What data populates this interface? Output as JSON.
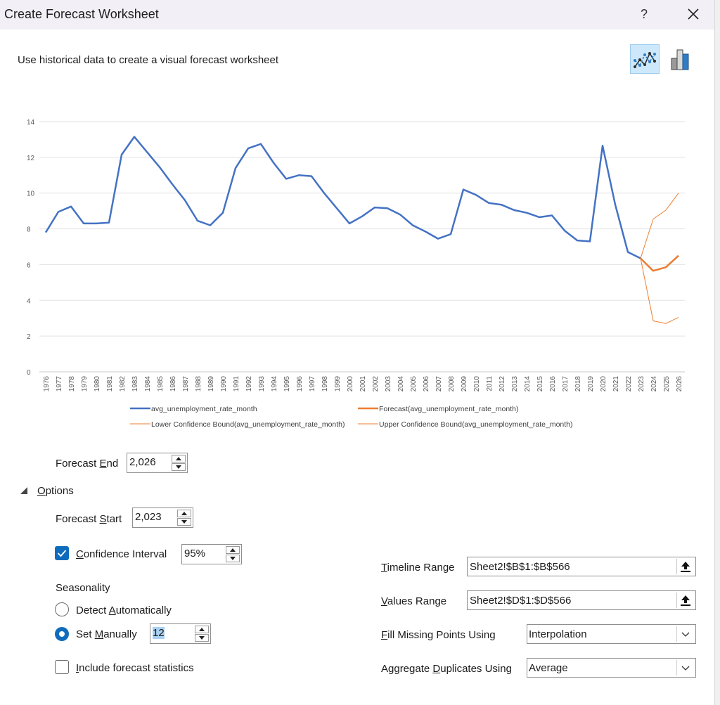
{
  "window": {
    "title": "Create Forecast Worksheet",
    "help": "?"
  },
  "subtitle": "Use historical data to create a visual forecast worksheet",
  "chart_type_buttons": [
    {
      "name": "line-chart",
      "selected": true
    },
    {
      "name": "column-chart",
      "selected": false
    }
  ],
  "chart_data": {
    "type": "line",
    "x": [
      1976,
      1977,
      1978,
      1979,
      1980,
      1981,
      1982,
      1983,
      1984,
      1985,
      1986,
      1987,
      1988,
      1989,
      1990,
      1991,
      1992,
      1993,
      1994,
      1995,
      1996,
      1997,
      1998,
      1999,
      2000,
      2001,
      2002,
      2003,
      2004,
      2005,
      2006,
      2007,
      2008,
      2009,
      2010,
      2011,
      2012,
      2013,
      2014,
      2015,
      2016,
      2017,
      2018,
      2019,
      2020,
      2021,
      2022,
      2023,
      2024,
      2025,
      2026
    ],
    "ylim": [
      0,
      14
    ],
    "yticks": [
      0,
      2,
      4,
      6,
      8,
      10,
      12,
      14
    ],
    "series": [
      {
        "name": "avg_unemployment_rate_month",
        "color": "#4472c4",
        "values": [
          7.8,
          8.95,
          9.25,
          8.3,
          8.3,
          8.35,
          12.15,
          13.15,
          12.3,
          11.45,
          10.5,
          9.6,
          8.45,
          8.2,
          8.9,
          11.4,
          12.5,
          12.75,
          11.7,
          10.8,
          11.0,
          10.95,
          10.0,
          9.15,
          8.3,
          8.7,
          9.2,
          9.15,
          8.8,
          8.2,
          7.85,
          7.45,
          7.7,
          10.2,
          9.9,
          9.45,
          9.35,
          9.05,
          8.9,
          8.65,
          8.75,
          7.9,
          7.35,
          7.3,
          12.65,
          9.35,
          6.7,
          6.35,
          null,
          null,
          null
        ]
      },
      {
        "name": "Forecast(avg_unemployment_rate_month)",
        "color": "#ed7d31",
        "values": [
          null,
          null,
          null,
          null,
          null,
          null,
          null,
          null,
          null,
          null,
          null,
          null,
          null,
          null,
          null,
          null,
          null,
          null,
          null,
          null,
          null,
          null,
          null,
          null,
          null,
          null,
          null,
          null,
          null,
          null,
          null,
          null,
          null,
          null,
          null,
          null,
          null,
          null,
          null,
          null,
          null,
          null,
          null,
          null,
          null,
          null,
          null,
          6.35,
          5.65,
          5.85,
          6.5
        ]
      },
      {
        "name": "Lower Confidence Bound(avg_unemployment_rate_month)",
        "color": "#ed7d31",
        "values": [
          null,
          null,
          null,
          null,
          null,
          null,
          null,
          null,
          null,
          null,
          null,
          null,
          null,
          null,
          null,
          null,
          null,
          null,
          null,
          null,
          null,
          null,
          null,
          null,
          null,
          null,
          null,
          null,
          null,
          null,
          null,
          null,
          null,
          null,
          null,
          null,
          null,
          null,
          null,
          null,
          null,
          null,
          null,
          null,
          null,
          null,
          null,
          6.35,
          2.85,
          2.7,
          3.05
        ]
      },
      {
        "name": "Upper Confidence Bound(avg_unemployment_rate_month)",
        "color": "#ed7d31",
        "values": [
          null,
          null,
          null,
          null,
          null,
          null,
          null,
          null,
          null,
          null,
          null,
          null,
          null,
          null,
          null,
          null,
          null,
          null,
          null,
          null,
          null,
          null,
          null,
          null,
          null,
          null,
          null,
          null,
          null,
          null,
          null,
          null,
          null,
          null,
          null,
          null,
          null,
          null,
          null,
          null,
          null,
          null,
          null,
          null,
          null,
          null,
          null,
          6.35,
          8.55,
          9.05,
          10.0
        ]
      }
    ],
    "grid": true,
    "legend_position": "bottom"
  },
  "form": {
    "forecast_end": {
      "label_pre": "Forecast ",
      "label_key": "E",
      "label_post": "nd",
      "value": "2,026"
    },
    "options_label_key": "O",
    "options_label_post": "ptions",
    "forecast_start": {
      "label_pre": "Forecast ",
      "label_key": "S",
      "label_post": "tart",
      "value": "2,023"
    },
    "confidence": {
      "label_key": "C",
      "label_post": "onfidence Interval",
      "value": "95%",
      "checked": true
    },
    "seasonality_label": "Seasonality",
    "detect_auto": {
      "label_pre": "Detect ",
      "label_key": "A",
      "label_post": "utomatically",
      "selected": false
    },
    "set_manually": {
      "label_pre": "Set ",
      "label_key": "M",
      "label_post": "anually",
      "selected": true,
      "value": "12"
    },
    "include_stats": {
      "label_key": "I",
      "label_post": "nclude forecast statistics",
      "checked": false
    },
    "timeline_range": {
      "label_key": "T",
      "label_post": "imeline Range",
      "value": "Sheet2!$B$1:$B$566"
    },
    "values_range": {
      "label_key": "V",
      "label_post": "alues Range",
      "value": "Sheet2!$D$1:$D$566"
    },
    "fill_missing": {
      "label_key": "F",
      "label_post": "ill Missing Points Using",
      "value": "Interpolation"
    },
    "aggregate": {
      "label_pre": "Aggregate ",
      "label_key": "D",
      "label_post": "uplicates Using",
      "value": "Average"
    }
  }
}
